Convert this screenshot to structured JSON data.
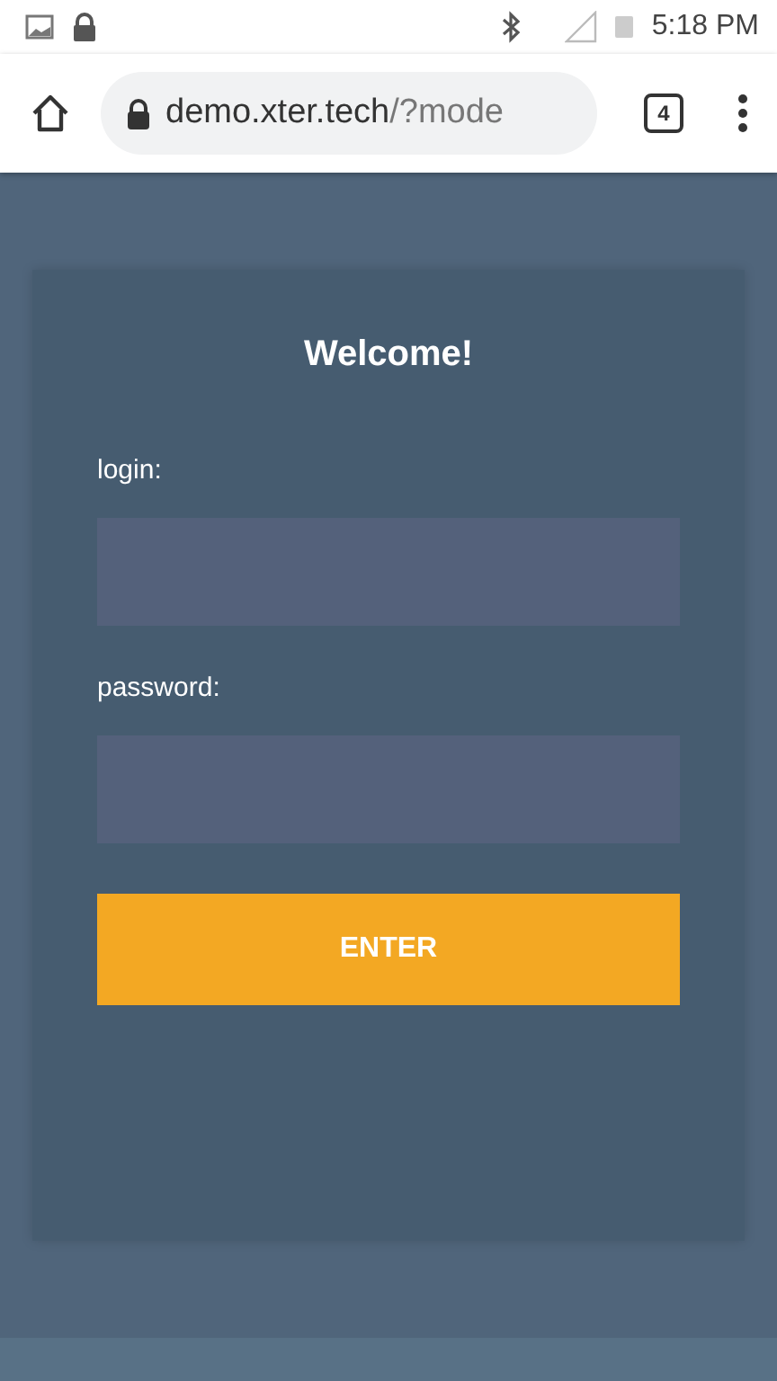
{
  "status_bar": {
    "time": "5:18 PM"
  },
  "browser": {
    "url_host": "demo.xter.tech",
    "url_path": "/?mode",
    "tab_count": "4"
  },
  "login_card": {
    "title": "Welcome!",
    "fields": [
      {
        "label": "login:"
      },
      {
        "label": "password:"
      }
    ],
    "submit": "ENTER"
  }
}
